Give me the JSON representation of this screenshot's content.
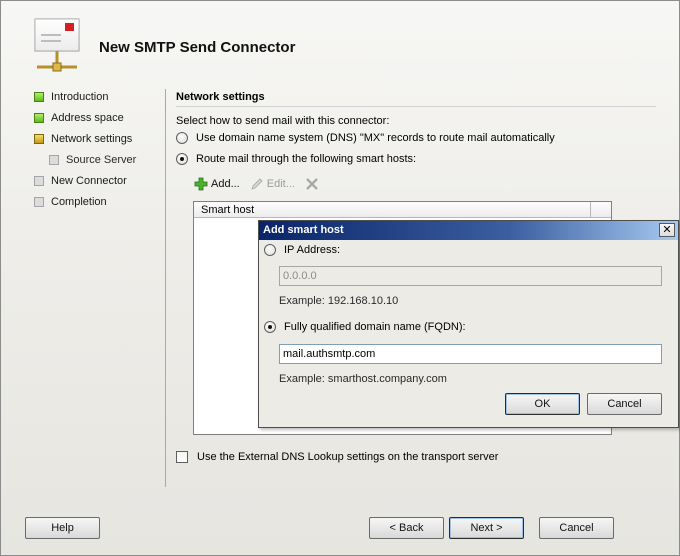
{
  "wizard": {
    "title": "New SMTP Send Connector",
    "steps": [
      {
        "label": "Introduction",
        "state": "complete"
      },
      {
        "label": "Address space",
        "state": "complete"
      },
      {
        "label": "Network settings",
        "state": "current"
      },
      {
        "label": "Source Server",
        "state": "pending",
        "sub": true
      },
      {
        "label": "New Connector",
        "state": "pending"
      },
      {
        "label": "Completion",
        "state": "pending"
      }
    ],
    "section_title": "Network settings",
    "prompt": "Select how to send mail with this connector:",
    "option_dns": "Use domain name system (DNS) \"MX\" records to route mail automatically",
    "option_smarthost": "Route mail through the following smart hosts:",
    "toolbar": {
      "add": "Add...",
      "edit": "Edit..."
    },
    "grid_header": "Smart host",
    "external_dns_checkbox": "Use the External DNS Lookup settings on the transport server",
    "buttons": {
      "help": "Help",
      "back": "< Back",
      "next": "Next >",
      "cancel": "Cancel"
    }
  },
  "dialog": {
    "title": "Add smart host",
    "ip_label": "IP Address:",
    "ip_value": "0.0.0.0",
    "ip_example": "Example: 192.168.10.10",
    "fqdn_label": "Fully qualified domain name (FQDN):",
    "fqdn_value": "mail.authsmtp.com",
    "fqdn_example": "Example: smarthost.company.com",
    "ok": "OK",
    "cancel": "Cancel",
    "close_glyph": "✕"
  },
  "colors": {
    "complete": "#5dba1b",
    "current": "#c59a12",
    "pending": "#dcdcdc",
    "titlebar": "#0a246a"
  }
}
